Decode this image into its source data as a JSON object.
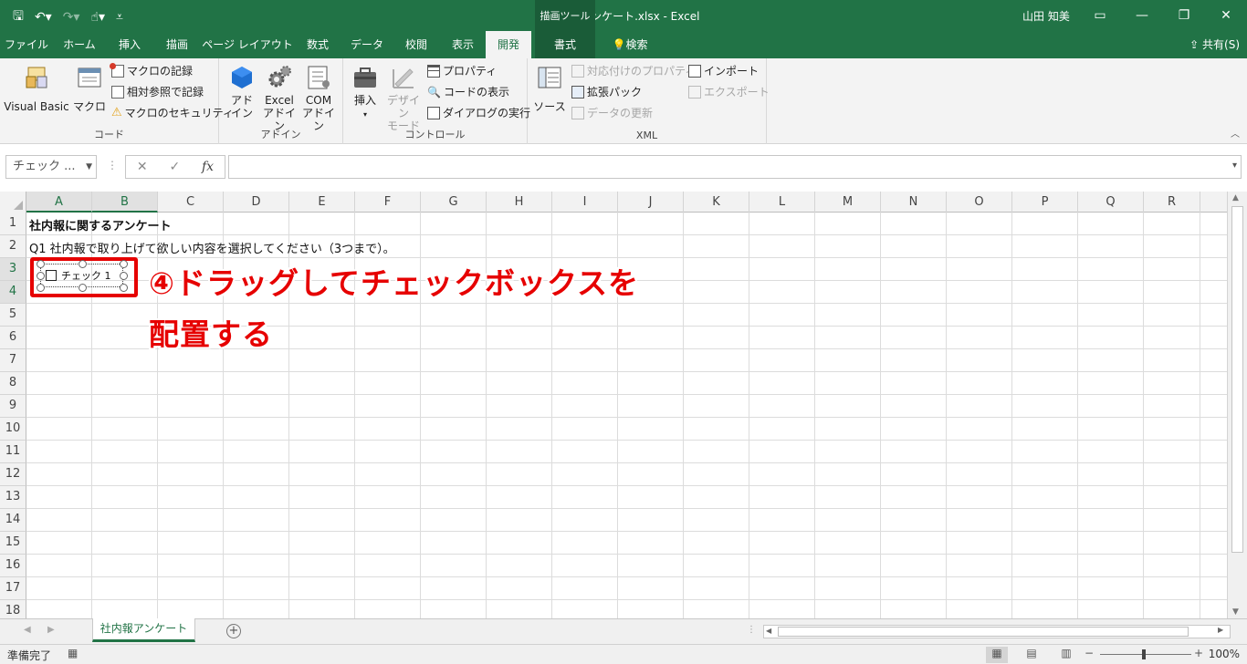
{
  "window": {
    "title": "社内報アンケート.xlsx  -  Excel",
    "context_tab_group": "描画ツール",
    "user": "山田 知美"
  },
  "tabs": [
    {
      "label": "ファイル"
    },
    {
      "label": "ホーム"
    },
    {
      "label": "挿入"
    },
    {
      "label": "描画"
    },
    {
      "label": "ページ レイアウト"
    },
    {
      "label": "数式"
    },
    {
      "label": "データ"
    },
    {
      "label": "校閲"
    },
    {
      "label": "表示"
    },
    {
      "label": "開発"
    },
    {
      "label": "書式"
    },
    {
      "label": "検索"
    }
  ],
  "share_label": "共有(S)",
  "ribbon": {
    "code": {
      "label": "コード",
      "visual_basic": "Visual Basic",
      "macro": "マクロ",
      "record_macro": "マクロの記録",
      "relative_ref": "相対参照で記録",
      "macro_security": "マクロのセキュリティ"
    },
    "addins": {
      "label": "アドイン",
      "addin_1": "アド",
      "addin_2": "イン",
      "excel_addin_1": "Excel",
      "excel_addin_2": "アドイン",
      "com_addin_1": "COM",
      "com_addin_2": "アドイン"
    },
    "controls": {
      "label": "コントロール",
      "insert": "挿入",
      "design_mode_1": "デザイン",
      "design_mode_2": "モード",
      "properties": "プロパティ",
      "view_code": "コードの表示",
      "run_dialog": "ダイアログの実行"
    },
    "xml": {
      "label": "XML",
      "source": "ソース",
      "map_properties": "対応付けのプロパティ",
      "expansion_packs": "拡張パック",
      "refresh_data": "データの更新",
      "import": "インポート",
      "export": "エクスポート"
    }
  },
  "formula_bar": {
    "name_box": "チェック ...",
    "cancel_glyph": "✕",
    "enter_glyph": "✓",
    "fx_label": "fx"
  },
  "columns": [
    "A",
    "B",
    "C",
    "D",
    "E",
    "F",
    "G",
    "H",
    "I",
    "J",
    "K",
    "L",
    "M",
    "N",
    "O",
    "P",
    "Q",
    "R"
  ],
  "rows": [
    "1",
    "2",
    "3",
    "4",
    "5",
    "6",
    "7",
    "8",
    "9",
    "10",
    "11",
    "12",
    "13",
    "14",
    "15",
    "16",
    "17",
    "18"
  ],
  "cells": {
    "A1": "社内報に関するアンケート",
    "A2": "Q1 社内報で取り上げて欲しい内容を選択してください（3つまで）。"
  },
  "checkbox": {
    "label": "チェック 1"
  },
  "annotation": {
    "line1": "④ドラッグしてチェックボックスを",
    "line2": "配置する",
    "color": "#e60000"
  },
  "sheet_tab": "社内報アンケート",
  "status": {
    "ready": "準備完了",
    "zoom": "100%"
  },
  "colors": {
    "excel_green": "#217346",
    "highlight_red": "#e60000"
  }
}
